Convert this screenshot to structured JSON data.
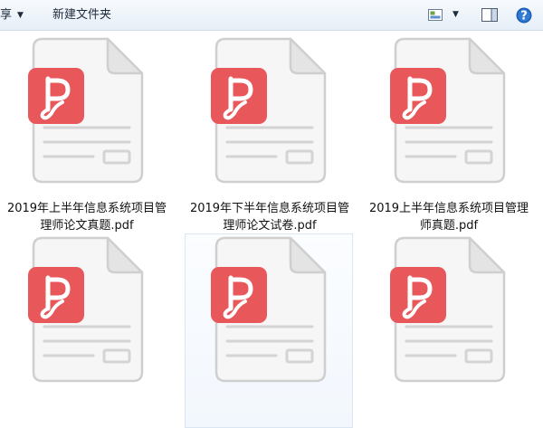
{
  "toolbar": {
    "share_label": "享",
    "new_folder_label": "新建文件夹",
    "icons": {
      "share_caret": "caret-down-icon",
      "view": "change-view-icon",
      "view_caret": "caret-down-icon",
      "preview": "preview-pane-icon",
      "help": "help-icon"
    }
  },
  "files": [
    {
      "name_line1": "2019年上半年信息系统项目管",
      "name_line2": "理师论文真题.pdf",
      "selected": false
    },
    {
      "name_line1": "2019年下半年信息系统项目管",
      "name_line2": "理师论文试卷.pdf",
      "selected": false
    },
    {
      "name_line1": "2019上半年信息系统项目管理",
      "name_line2": "师真题.pdf",
      "selected": false
    },
    {
      "name_line1": "",
      "name_line2": "",
      "selected": false
    },
    {
      "name_line1": "",
      "name_line2": "",
      "selected": true
    },
    {
      "name_line1": "",
      "name_line2": "",
      "selected": false
    }
  ],
  "file_icon": {
    "name": "pdf-file-icon",
    "badge_color": "#e8575a",
    "page_color": "#f6f6f6",
    "outline_color": "#cfcfcf"
  }
}
